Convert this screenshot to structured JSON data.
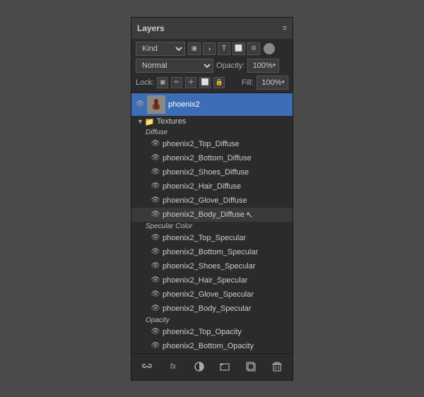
{
  "panel": {
    "title": "Layers",
    "close_label": "×",
    "collapse_label": "«",
    "menu_label": "≡"
  },
  "controls": {
    "kind_label": "Kind",
    "blend_mode": "Normal",
    "opacity_label": "Opacity:",
    "opacity_value": "100%",
    "lock_label": "Lock:",
    "fill_label": "Fill:",
    "fill_value": "100%"
  },
  "layers": [
    {
      "type": "group",
      "name": "phoenix2",
      "selected": true,
      "children": [
        {
          "type": "folder",
          "name": "Textures",
          "children": [
            {
              "type": "category",
              "name": "Diffuse"
            },
            {
              "type": "layer",
              "name": "phoenix2_Top_Diffuse"
            },
            {
              "type": "layer",
              "name": "phoenix2_Bottom_Diffuse"
            },
            {
              "type": "layer",
              "name": "phoenix2_Shoes_Diffuse"
            },
            {
              "type": "layer",
              "name": "phoenix2_Hair_Diffuse"
            },
            {
              "type": "layer",
              "name": "phoenix2_Glove_Diffuse"
            },
            {
              "type": "layer",
              "name": "phoenix2_Body_Diffuse",
              "hovered": true
            },
            {
              "type": "category",
              "name": "Specular Color"
            },
            {
              "type": "layer",
              "name": "phoenix2_Top_Specular"
            },
            {
              "type": "layer",
              "name": "phoenix2_Bottom_Specular"
            },
            {
              "type": "layer",
              "name": "phoenix2_Shoes_Specular"
            },
            {
              "type": "layer",
              "name": "phoenix2_Hair_Specular"
            },
            {
              "type": "layer",
              "name": "phoenix2_Glove_Specular"
            },
            {
              "type": "layer",
              "name": "phoenix2_Body_Specular"
            },
            {
              "type": "category",
              "name": "Opacity"
            },
            {
              "type": "layer",
              "name": "phoenix2_Top_Opacity"
            },
            {
              "type": "layer",
              "name": "phoenix2_Bottom_Opacity"
            }
          ]
        }
      ]
    }
  ],
  "bottom_bar": {
    "link_label": "🔗",
    "fx_label": "fx",
    "new_layer_label": "◻",
    "brush_label": "◉",
    "folder_label": "📁",
    "adjustment_label": "◑",
    "delete_label": "🗑"
  }
}
